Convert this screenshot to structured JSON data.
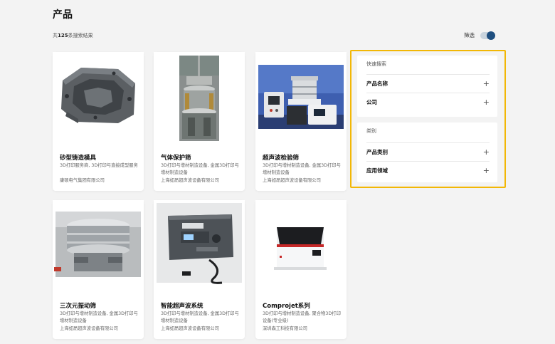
{
  "header": {
    "title": "产品",
    "result_count_prefix": "共",
    "result_count_number": "125",
    "result_count_suffix": "条搜索结果",
    "filter_label": "筛选",
    "filter_enabled": true
  },
  "products": [
    {
      "title": "砂型铸造模具",
      "tags": "3D打印服务商, 3D打印与直接成型服务",
      "company": "康硕电气集团有限公司"
    },
    {
      "title": "气体保护筛",
      "tags": "3D打印与增材制造设备, 金属3D打印与增材制造设备",
      "company": "上海如昂超声波设备有限公司"
    },
    {
      "title": "超声波检验筛",
      "tags": "3D打印与增材制造设备, 金属3D打印与增材制造设备",
      "company": "上海如昂超声波设备有限公司"
    },
    {
      "title": "三次元振动筛",
      "tags": "3D打印与增材制造设备, 金属3D打印与增材制造设备",
      "company": "上海如昂超声波设备有限公司"
    },
    {
      "title": "智能超声波系统",
      "tags": "3D打印与增材制造设备, 金属3D打印与增材制造设备",
      "company": "上海如昂超声波设备有限公司"
    },
    {
      "title": "Comprojet系列",
      "tags": "3D打印与增材制造设备, 聚合物3D打印设备(专业级)",
      "company": "深圳森工科技有限公司"
    }
  ],
  "sidebar": {
    "quick_search": {
      "heading": "快速搜索",
      "rows": [
        {
          "label": "产品名称"
        },
        {
          "label": "公司"
        }
      ]
    },
    "category": {
      "heading": "类别",
      "rows": [
        {
          "label": "产品类别"
        },
        {
          "label": "应用领域"
        }
      ]
    },
    "expand_symbol": "+"
  },
  "colors": {
    "highlight_border": "#f2b705",
    "toggle_on": "#1f4f80"
  }
}
